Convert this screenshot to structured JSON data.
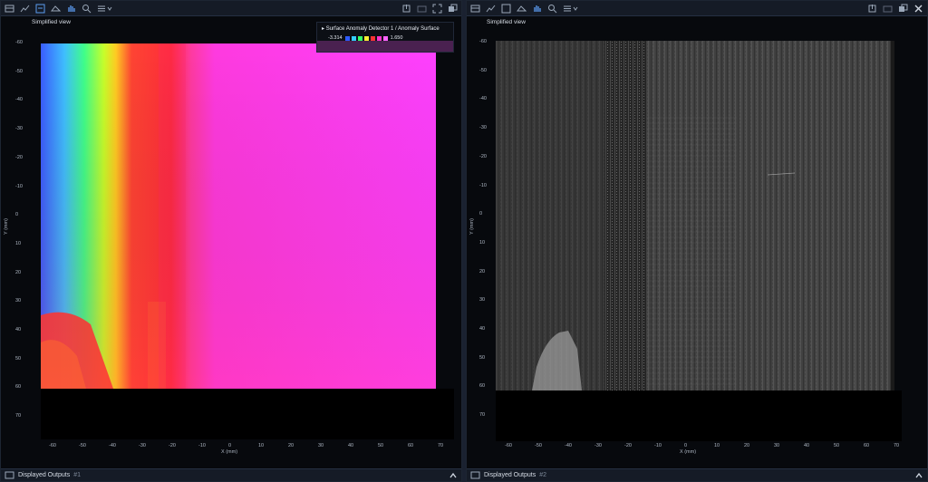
{
  "panels": [
    {
      "view_label": "Simplified view",
      "legend": {
        "title": "Surface Anomaly Detector 1 / Anomaly Surface",
        "min": "-3.314",
        "max": "1.650",
        "swatches": [
          "#2d5bff",
          "#33ccff",
          "#33ff66",
          "#ffee33",
          "#ff3333",
          "#ff33cc",
          "#ff66ff"
        ]
      },
      "x_ticks": [
        "-60",
        "-50",
        "-40",
        "-30",
        "-20",
        "-10",
        "0",
        "10",
        "20",
        "30",
        "40",
        "50",
        "60",
        "70"
      ],
      "y_ticks": [
        "-60",
        "-50",
        "-40",
        "-30",
        "-20",
        "-10",
        "0",
        "10",
        "20",
        "30",
        "40",
        "50",
        "60",
        "70"
      ],
      "x_title": "X (mm)",
      "y_title": "Y (mm)",
      "footer_label": "Displayed Outputs",
      "footer_num": "#1"
    },
    {
      "view_label": "Simplified view",
      "x_ticks": [
        "-60",
        "-50",
        "-40",
        "-30",
        "-20",
        "-10",
        "0",
        "10",
        "20",
        "30",
        "40",
        "50",
        "60",
        "70"
      ],
      "y_ticks": [
        "-60",
        "-50",
        "-40",
        "-30",
        "-20",
        "-10",
        "0",
        "10",
        "20",
        "30",
        "40",
        "50",
        "60",
        "70"
      ],
      "x_title": "X (mm)",
      "y_title": "Y (mm)",
      "footer_label": "Displayed Outputs",
      "footer_num": "#2"
    }
  ]
}
